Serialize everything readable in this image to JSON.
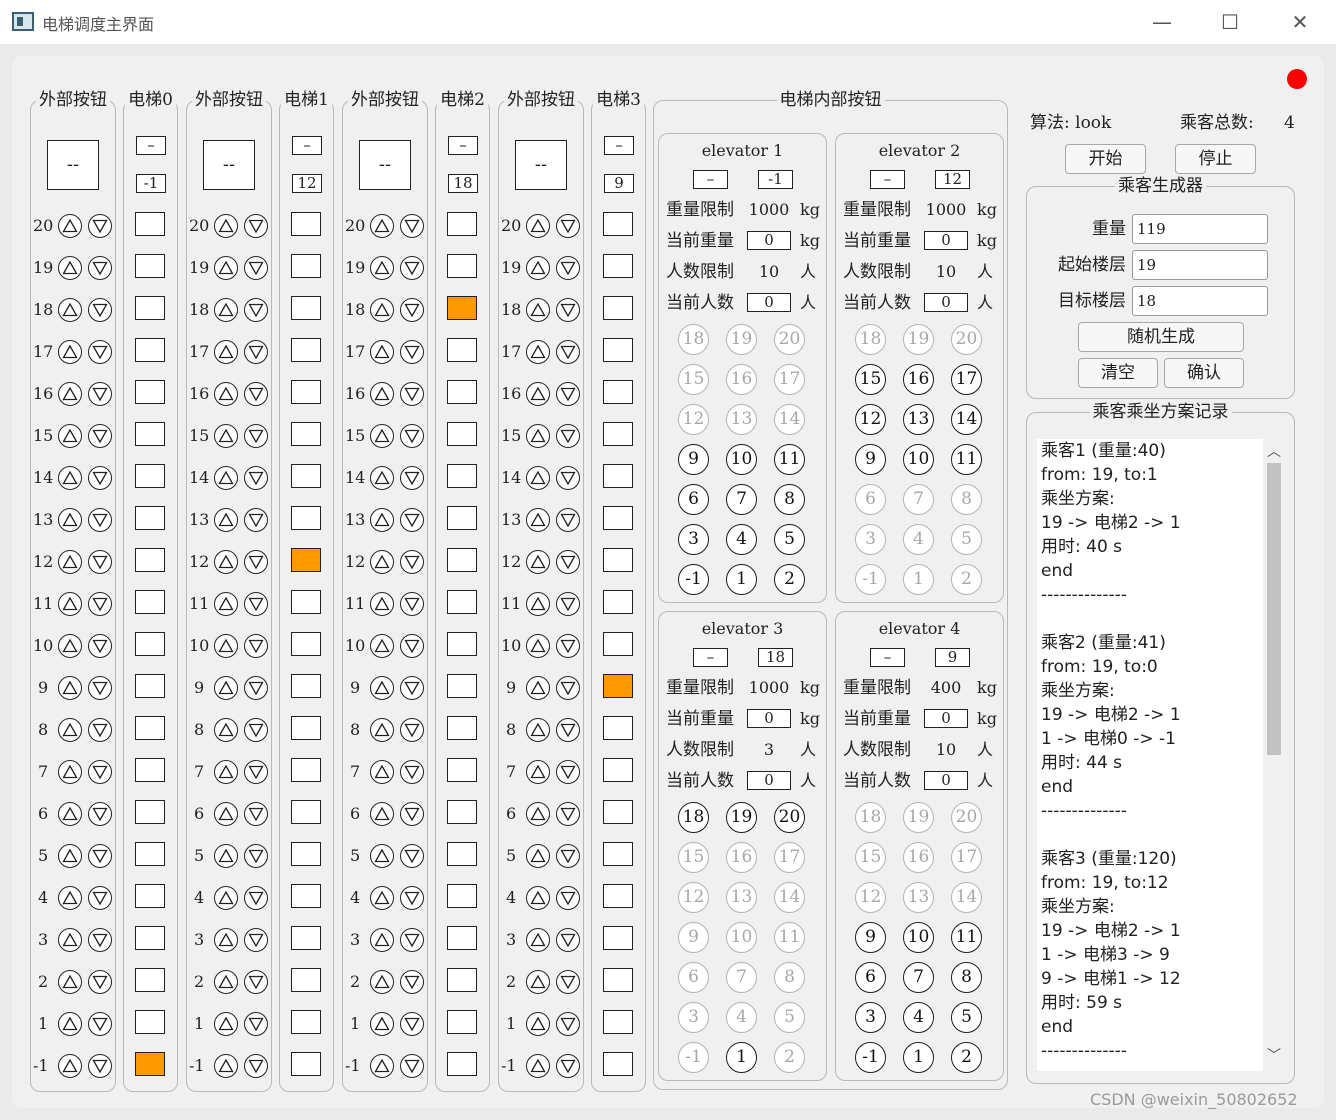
{
  "window": {
    "title": "电梯调度主界面",
    "min_glyph": "—",
    "max_glyph": "☐",
    "close_glyph": "✕"
  },
  "floors": [
    "20",
    "19",
    "18",
    "17",
    "16",
    "15",
    "14",
    "13",
    "12",
    "11",
    "10",
    "9",
    "8",
    "7",
    "6",
    "5",
    "4",
    "3",
    "2",
    "1",
    "-1"
  ],
  "columns": [
    {
      "outer_title": "外部按钮",
      "outer_display": "--",
      "elevator_title": "电梯0",
      "direction": "–",
      "current_floor": "-1"
    },
    {
      "outer_title": "外部按钮",
      "outer_display": "--",
      "elevator_title": "电梯1",
      "direction": "–",
      "current_floor": "12"
    },
    {
      "outer_title": "外部按钮",
      "outer_display": "--",
      "elevator_title": "电梯2",
      "direction": "–",
      "current_floor": "18"
    },
    {
      "outer_title": "外部按钮",
      "outer_display": "--",
      "elevator_title": "电梯3",
      "direction": "–",
      "current_floor": "9"
    }
  ],
  "inner": {
    "title": "电梯内部按钮",
    "labels": {
      "weight_limit": "重量限制",
      "current_weight": "当前重量",
      "people_limit": "人数限制",
      "current_people": "当前人数",
      "kg": "kg",
      "person": "人"
    },
    "button_rows": [
      [
        "18",
        "19",
        "20"
      ],
      [
        "15",
        "16",
        "17"
      ],
      [
        "12",
        "13",
        "14"
      ],
      [
        "9",
        "10",
        "11"
      ],
      [
        "6",
        "7",
        "8"
      ],
      [
        "3",
        "4",
        "5"
      ],
      [
        "-1",
        "1",
        "2"
      ]
    ],
    "panels": [
      {
        "name": "elevator 1",
        "direction": "–",
        "floor": "-1",
        "weight_limit": "1000",
        "current_weight": "0",
        "people_limit": "10",
        "current_people": "0",
        "enabled": [
          "9",
          "10",
          "11",
          "6",
          "7",
          "8",
          "3",
          "4",
          "5",
          "-1",
          "1",
          "2"
        ]
      },
      {
        "name": "elevator 2",
        "direction": "–",
        "floor": "12",
        "weight_limit": "1000",
        "current_weight": "0",
        "people_limit": "10",
        "current_people": "0",
        "enabled": [
          "15",
          "16",
          "17",
          "12",
          "13",
          "14",
          "9",
          "10",
          "11"
        ]
      },
      {
        "name": "elevator 3",
        "direction": "–",
        "floor": "18",
        "weight_limit": "1000",
        "current_weight": "0",
        "people_limit": "3",
        "current_people": "0",
        "enabled": [
          "18",
          "19",
          "20",
          "1"
        ]
      },
      {
        "name": "elevator 4",
        "direction": "–",
        "floor": "9",
        "weight_limit": "400",
        "current_weight": "0",
        "people_limit": "10",
        "current_people": "0",
        "enabled": [
          "9",
          "10",
          "11",
          "6",
          "7",
          "8",
          "3",
          "4",
          "5",
          "-1",
          "1",
          "2"
        ]
      }
    ]
  },
  "controls": {
    "algorithm_label": "算法: look",
    "total_label": "乘客总数:",
    "total_value": "4",
    "start": "开始",
    "stop": "停止"
  },
  "generator": {
    "title": "乘客生成器",
    "weight_label": "重量",
    "weight_value": "119",
    "start_floor_label": "起始楼层",
    "start_floor_value": "19",
    "target_floor_label": "目标楼层",
    "target_floor_value": "18",
    "random": "随机生成",
    "clear": "清空",
    "confirm": "确认"
  },
  "log": {
    "title": "乘客乘坐方案记录",
    "lines": [
      "乘客1 (重量:40)",
      "from: 19, to:1",
      "乘坐方案:",
      "19 -> 电梯2 -> 1",
      "用时: 40 s",
      "end",
      "--------------",
      "",
      "乘客2 (重量:41)",
      "from: 19, to:0",
      "乘坐方案:",
      "19 -> 电梯2 -> 1",
      "1 -> 电梯0 -> -1",
      "用时: 44 s",
      "end",
      "--------------",
      "",
      "乘客3 (重量:120)",
      "from: 19, to:12",
      "乘坐方案:",
      "19 -> 电梯2 -> 1",
      "1 -> 电梯3 -> 9",
      "9 -> 电梯1 -> 12",
      "用时: 59 s",
      "end",
      "--------------"
    ]
  },
  "watermark": "CSDN @weixin_50802652",
  "colors": {
    "active_floor": "#ff9900",
    "status_dot": "#ff0000"
  }
}
